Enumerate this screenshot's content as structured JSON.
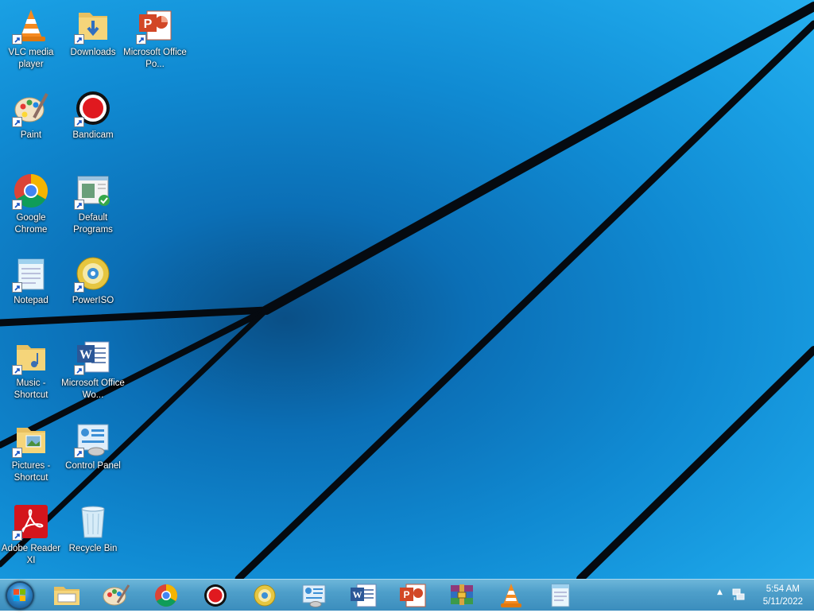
{
  "desktop": {
    "icons": [
      {
        "label": "VLC media player",
        "icon": "vlc-icon"
      },
      {
        "label": "Downloads",
        "icon": "downloads-folder-icon"
      },
      {
        "label": "Microsoft Office Po...",
        "icon": "powerpoint-icon"
      },
      {
        "label": "Paint",
        "icon": "paint-icon"
      },
      {
        "label": "Bandicam",
        "icon": "bandicam-icon"
      },
      {
        "label": "Google Chrome",
        "icon": "chrome-icon"
      },
      {
        "label": "Default Programs",
        "icon": "default-programs-icon"
      },
      {
        "label": "Notepad",
        "icon": "notepad-icon"
      },
      {
        "label": "PowerISO",
        "icon": "poweriso-icon"
      },
      {
        "label": "Music - Shortcut",
        "icon": "music-folder-icon"
      },
      {
        "label": "Microsoft Office Wo...",
        "icon": "word-icon"
      },
      {
        "label": "Pictures - Shortcut",
        "icon": "pictures-folder-icon"
      },
      {
        "label": "Control Panel",
        "icon": "control-panel-icon"
      },
      {
        "label": "Adobe Reader XI",
        "icon": "adobe-reader-icon"
      },
      {
        "label": "Recycle Bin",
        "icon": "recycle-bin-icon"
      }
    ]
  },
  "taskbar": {
    "start_button": "start-orb-icon",
    "pinned": [
      "explorer-icon",
      "paint-icon",
      "chrome-icon",
      "bandicam-icon",
      "poweriso-icon",
      "control-panel-icon",
      "word-icon",
      "powerpoint-icon",
      "winrar-icon",
      "vlc-icon",
      "notepad-icon"
    ],
    "tray": {
      "show_hidden_icons": "▲",
      "network_icon": "network-icon",
      "time": "5:54 AM",
      "date": "5/11/2022"
    }
  }
}
